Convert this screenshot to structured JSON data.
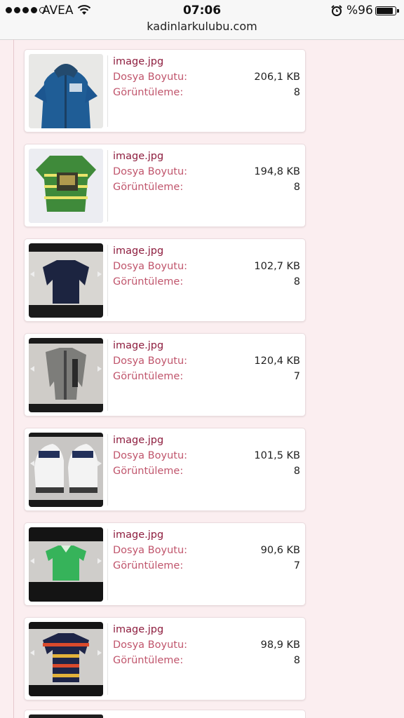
{
  "status_bar": {
    "carrier": "AVEA",
    "time": "07:06",
    "battery_text": "%96",
    "battery_level": 0.96,
    "signal_bars_filled": 4,
    "signal_bars_total": 5
  },
  "address_bar": {
    "url": "kadinlarkulubu.com"
  },
  "labels": {
    "size_label": "Dosya Boyutu:",
    "views_label": "Görüntüleme:"
  },
  "files": [
    {
      "name": "image.jpg",
      "size": "206,1 KB",
      "views": "8",
      "thumb": "blue-hoodie"
    },
    {
      "name": "image.jpg",
      "size": "194,8 KB",
      "views": "8",
      "thumb": "green-striped-shirt"
    },
    {
      "name": "image.jpg",
      "size": "102,7 KB",
      "views": "8",
      "thumb": "navy-sweater"
    },
    {
      "name": "image.jpg",
      "size": "120,4 KB",
      "views": "7",
      "thumb": "grey-jacket"
    },
    {
      "name": "image.jpg",
      "size": "101,5 KB",
      "views": "8",
      "thumb": "white-sneakers"
    },
    {
      "name": "image.jpg",
      "size": "90,6 KB",
      "views": "7",
      "thumb": "green-polo"
    },
    {
      "name": "image.jpg",
      "size": "98,9 KB",
      "views": "8",
      "thumb": "striped-polo"
    }
  ]
}
